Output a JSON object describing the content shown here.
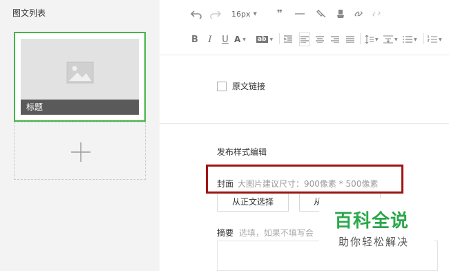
{
  "left_panel": {
    "title": "图文列表",
    "card_caption": "标题"
  },
  "toolbar": {
    "font_size": "16px",
    "icons_row1": [
      "undo-icon",
      "redo-icon",
      "font-size-select",
      "blockquote-icon",
      "horizontal-rule-icon",
      "format-paint-icon",
      "clear-format-icon",
      "link-icon",
      "unlink-icon"
    ],
    "icons_row2": [
      "bold-icon",
      "italic-icon",
      "underline-icon",
      "font-color-icon",
      "background-color-icon",
      "indent-icon",
      "align-left-icon",
      "align-center-icon",
      "align-right-icon",
      "align-justify-icon",
      "line-spacing-icon",
      "paragraph-spacing-icon",
      "list-icon",
      "ordered-list-icon"
    ],
    "bold": "B",
    "italic": "I",
    "underline": "U",
    "font_color": "A",
    "bg_color": "ab"
  },
  "content": {
    "original_link_label": "原文链接",
    "publish_title": "发布样式编辑",
    "cover_label": "封面",
    "cover_hint": "大图片建议尺寸：900像素 * 500像素",
    "select_from_text_button": "从正文选择",
    "select_from_library_button": "从",
    "summary_label": "摘要",
    "summary_placeholder": "选填，如果不填写会"
  },
  "watermark": {
    "title": "百科全说",
    "subtitle": "助你轻松解决"
  },
  "colors": {
    "accent_green": "#43b548",
    "highlight_red": "#9e1111",
    "watermark_green": "#2aa84a"
  }
}
